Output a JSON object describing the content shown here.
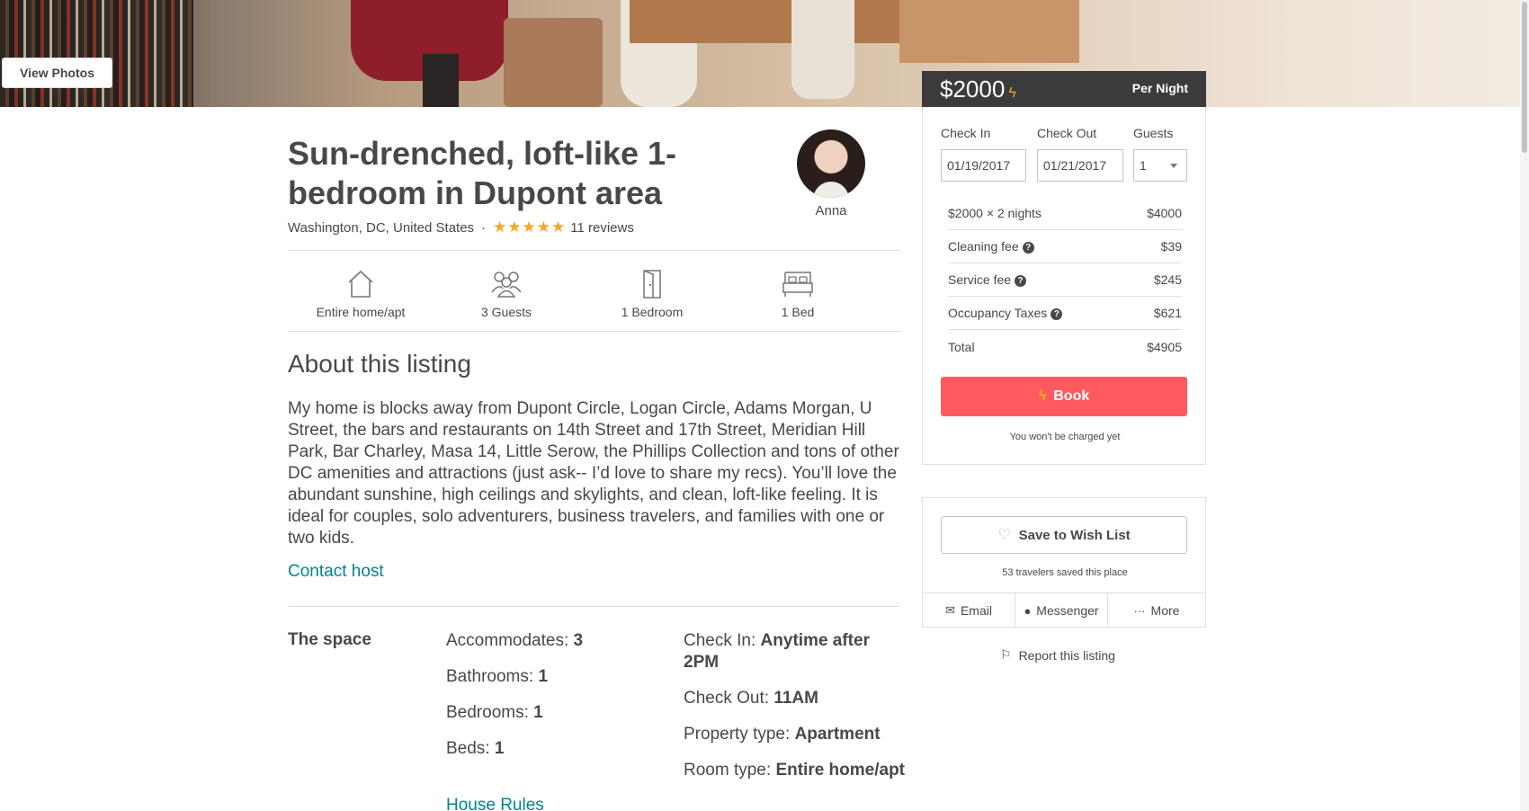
{
  "hero": {
    "view_photos_label": "View Photos"
  },
  "listing": {
    "title": "Sun-drenched, loft-like 1-bedroom in Dupont area",
    "location": "Washington, DC, United States",
    "separator": "·",
    "rating_stars": 5,
    "reviews": "11 reviews",
    "host_name": "Anna"
  },
  "amenities": [
    {
      "icon": "house-icon",
      "label": "Entire home/apt"
    },
    {
      "icon": "guests-icon",
      "label": "3 Guests"
    },
    {
      "icon": "door-icon",
      "label": "1 Bedroom"
    },
    {
      "icon": "bed-icon",
      "label": "1 Bed"
    }
  ],
  "about": {
    "heading": "About this listing",
    "text": "My home is blocks away from Dupont Circle, Logan Circle, Adams Morgan, U Street, the bars and restaurants on 14th Street and 17th Street, Meridian Hill Park, Bar Charley, Masa 14, Little Serow, the Phillips Collection and tons of other DC amenities and attractions (just ask-- I’d love to share my recs). You’ll love the abundant sunshine, high ceilings and skylights, and clean, loft-like feeling. It is ideal for couples, solo adventurers, business travelers, and families with one or two kids.",
    "contact_label": "Contact host"
  },
  "space": {
    "label": "The space",
    "left": [
      {
        "key": "Accommodates: ",
        "value": "3"
      },
      {
        "key": "Bathrooms: ",
        "value": "1"
      },
      {
        "key": "Bedrooms: ",
        "value": "1"
      },
      {
        "key": "Beds: ",
        "value": "1"
      }
    ],
    "right": [
      {
        "key": "Check In: ",
        "value": "Anytime after 2PM"
      },
      {
        "key": "Check Out: ",
        "value": "11AM"
      },
      {
        "key": "Property type: ",
        "value": "Apartment"
      },
      {
        "key": "Room type: ",
        "value": "Entire home/apt"
      }
    ],
    "house_rules_label": "House Rules"
  },
  "booking": {
    "price": "$2000",
    "per": "Per Night",
    "checkin_label": "Check In",
    "checkout_label": "Check Out",
    "guests_label": "Guests",
    "checkin_value": "01/19/2017",
    "checkout_value": "01/21/2017",
    "guests_value": "1",
    "costs": [
      {
        "label": "$2000 × 2 nights",
        "value": "$4000",
        "help": false
      },
      {
        "label": "Cleaning fee",
        "value": "$39",
        "help": true
      },
      {
        "label": "Service fee",
        "value": "$245",
        "help": true
      },
      {
        "label": "Occupancy Taxes",
        "value": "$621",
        "help": true
      },
      {
        "label": "Total",
        "value": "$4905",
        "help": false
      }
    ],
    "book_label": "Book",
    "no_charge": "You won't be charged yet"
  },
  "wishlist": {
    "save_label": "Save to Wish List",
    "saved_text": "53 travelers saved this place",
    "share": [
      {
        "icon": "email-icon",
        "label": "Email"
      },
      {
        "icon": "messenger-icon",
        "label": "Messenger"
      },
      {
        "icon": "more-icon",
        "label": "More"
      }
    ],
    "report_label": "Report this listing"
  },
  "colors": {
    "accent": "#ff5a5f",
    "link": "#008489",
    "star": "#f5a623",
    "price_bar": "#3b3b3b"
  }
}
